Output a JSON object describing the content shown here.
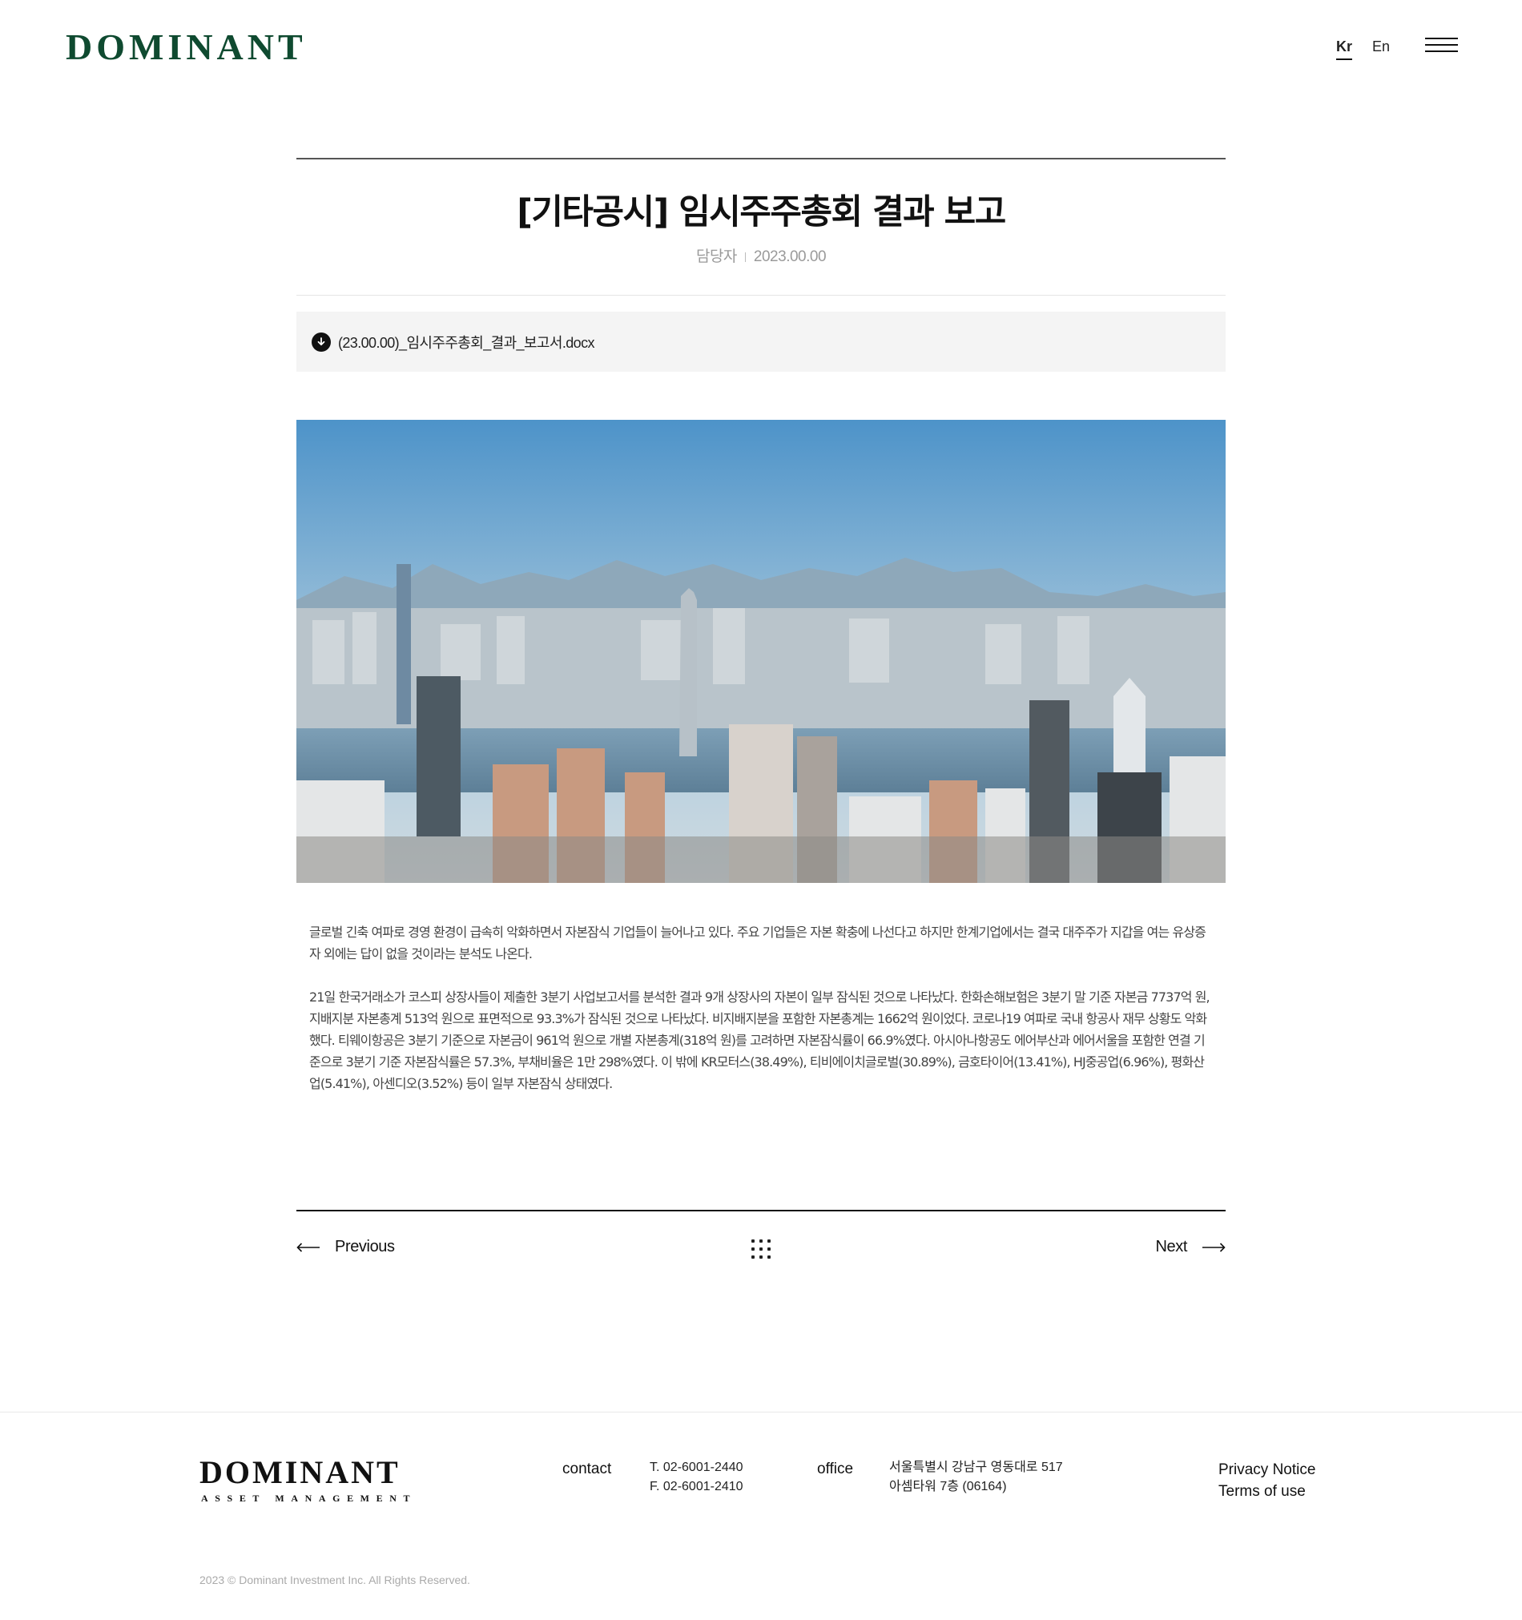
{
  "header": {
    "logo": "DOMINANT",
    "lang_kr": "Kr",
    "lang_en": "En",
    "menu_icon": "hamburger-menu-icon"
  },
  "article": {
    "title": "[기타공시] 임시주주총회 결과 보고",
    "author": "담당자",
    "date": "2023.00.00",
    "attachment": {
      "icon": "download-icon",
      "filename": "(23.00.00)_임시주주총회_결과_보고서.docx"
    },
    "image": {
      "alt": "city skyline photo"
    },
    "paragraphs": [
      "글로벌 긴축 여파로 경영 환경이 급속히 악화하면서 자본잠식 기업들이 늘어나고 있다. 주요 기업들은 자본 확충에 나선다고 하지만 한계기업에서는 결국 대주주가 지갑을 여는 유상증자 외에는 답이 없을 것이라는 분석도 나온다.",
      "21일 한국거래소가 코스피 상장사들이 제출한 3분기 사업보고서를 분석한 결과 9개 상장사의 자본이 일부 잠식된 것으로 나타났다. 한화손해보험은 3분기 말 기준 자본금 7737억 원, 지배지분 자본총계 513억 원으로 표면적으로 93.3%가 잠식된 것으로 나타났다. 비지배지분을 포함한 자본총계는 1662억 원이었다. 코로나19 여파로 국내 항공사 재무 상황도 악화했다. 티웨이항공은 3분기 기준으로 자본금이 961억 원으로 개별 자본총계(318억 원)를 고려하면 자본잠식률이 66.9%였다. 아시아나항공도 에어부산과 에어서울을 포함한 연결 기준으로 3분기 기준 자본잠식률은 57.3%, 부채비율은 1만 298%였다. 이 밖에 KR모터스(38.49%), 티비에이치글로벌(30.89%), 금호타이어(13.41%), HJ중공업(6.96%), 평화산업(5.41%), 아센디오(3.52%) 등이 일부 자본잠식 상태였다."
    ]
  },
  "pager": {
    "prev_label": "Previous",
    "next_label": "Next",
    "prev_icon": "arrow-left-icon",
    "next_icon": "arrow-right-icon",
    "list_icon": "grid-list-icon"
  },
  "footer": {
    "logo": "DOMINANT",
    "sub": "ASSET MANAGEMENT",
    "contact_label": "contact",
    "tel": "T. 02-6001-2440",
    "fax": "F. 02-6001-2410",
    "office_label": "office",
    "address_line1": "서울특별시 강남구 영동대로 517",
    "address_line2": "아셈타워 7층 (06164)",
    "privacy": "Privacy Notice",
    "terms": "Terms of use",
    "copyright": "2023 © Dominant Investment Inc. All Rights Reserved."
  },
  "colors": {
    "brand_green": "#0f4a30",
    "text": "#111111",
    "muted": "#9a9a9a",
    "attachment_bg": "#f4f4f4"
  }
}
